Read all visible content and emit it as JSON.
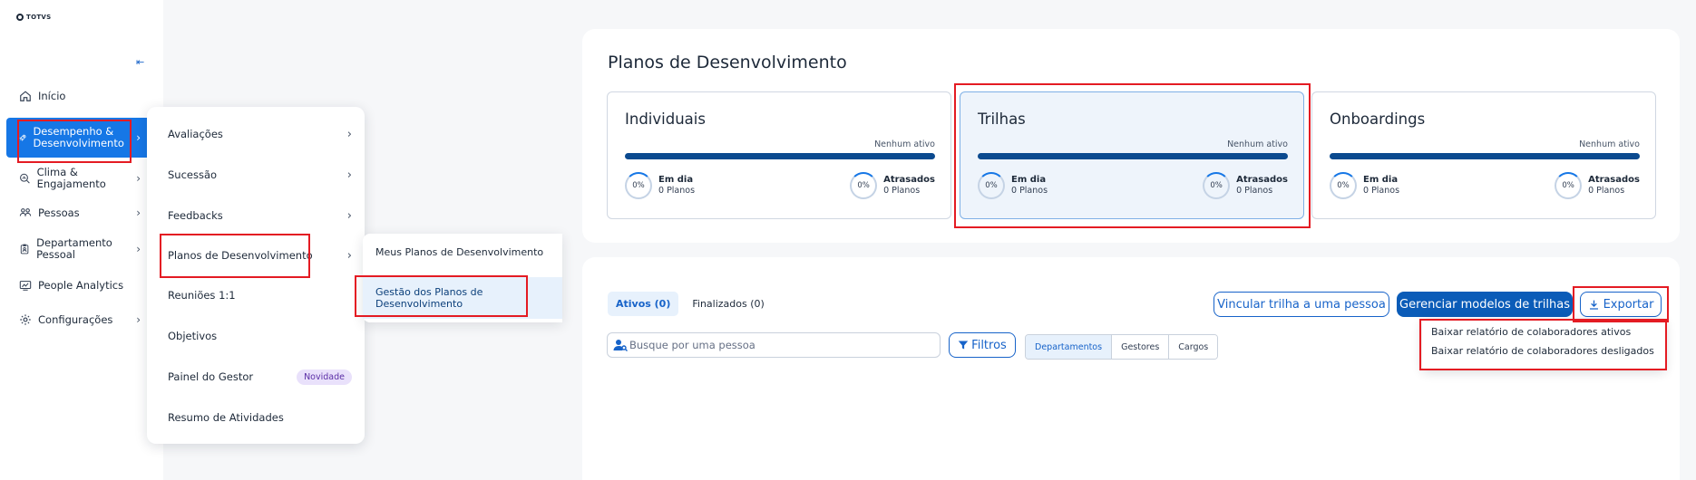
{
  "logo_text": "TOTVS",
  "sidebar": {
    "collapse_symbol": "⇤",
    "items": [
      {
        "label": "Início",
        "icon": "home-icon",
        "has_children": false
      },
      {
        "label": "Desempenho & Desenvolvimento",
        "icon": "rocket-icon",
        "has_children": true,
        "active": true
      },
      {
        "label": "Clima & Engajamento",
        "icon": "search-chart-icon",
        "has_children": true
      },
      {
        "label": "Pessoas",
        "icon": "people-icon",
        "has_children": true
      },
      {
        "label": "Departamento Pessoal",
        "icon": "badge-icon",
        "has_children": true
      },
      {
        "label": "People Analytics",
        "icon": "analytics-icon",
        "has_children": false
      },
      {
        "label": "Configurações",
        "icon": "gear-icon",
        "has_children": true
      }
    ]
  },
  "submenu": {
    "items": [
      {
        "label": "Avaliações",
        "has_children": true
      },
      {
        "label": "Sucessão",
        "has_children": true
      },
      {
        "label": "Feedbacks",
        "has_children": true
      },
      {
        "label": "Planos de Desenvolvimento",
        "has_children": true
      },
      {
        "label": "Reuniões 1:1",
        "has_children": false
      },
      {
        "label": "Objetivos",
        "has_children": false
      },
      {
        "label": "Painel do Gestor",
        "has_children": false,
        "badge": "Novidade"
      },
      {
        "label": "Resumo de Atividades",
        "has_children": false
      }
    ]
  },
  "submenu2": {
    "items": [
      {
        "label": "Meus Planos de Desenvolvimento"
      },
      {
        "label": "Gestão dos Planos de Desenvolvimento",
        "selected": true
      }
    ]
  },
  "main": {
    "title": "Planos de Desenvolvimento",
    "cards": [
      {
        "title": "Individuais",
        "status": "Nenhum ativo",
        "on_time_pct": "0%",
        "on_time_label": "Em dia",
        "on_time_count": "0 Planos",
        "late_pct": "0%",
        "late_label": "Atrasados",
        "late_count": "0 Planos"
      },
      {
        "title": "Trilhas",
        "status": "Nenhum ativo",
        "on_time_pct": "0%",
        "on_time_label": "Em dia",
        "on_time_count": "0 Planos",
        "late_pct": "0%",
        "late_label": "Atrasados",
        "late_count": "0 Planos"
      },
      {
        "title": "Onboardings",
        "status": "Nenhum ativo",
        "on_time_pct": "0%",
        "on_time_label": "Em dia",
        "on_time_count": "0 Planos",
        "late_pct": "0%",
        "late_label": "Atrasados",
        "late_count": "0 Planos"
      }
    ],
    "tabs": [
      {
        "label": "Ativos (0)",
        "active": true
      },
      {
        "label": "Finalizados (0)",
        "active": false
      }
    ],
    "buttons": {
      "link_track": "Vincular trilha a uma pessoa",
      "manage_models": "Gerenciar modelos de trilhas",
      "export": "Exportar"
    },
    "search": {
      "placeholder": "Busque por uma pessoa"
    },
    "filters_label": "Filtros",
    "segments": [
      "Departamentos",
      "Gestores",
      "Cargos"
    ],
    "export_menu": [
      "Baixar relatório de colaboradores ativos",
      "Baixar relatório de colaboradores desligados"
    ]
  },
  "colors": {
    "primary": "#1677e6",
    "primary_dark": "#0b5cb8",
    "annotation_red": "#e41b23",
    "badge_bg": "#e9e1fb"
  }
}
